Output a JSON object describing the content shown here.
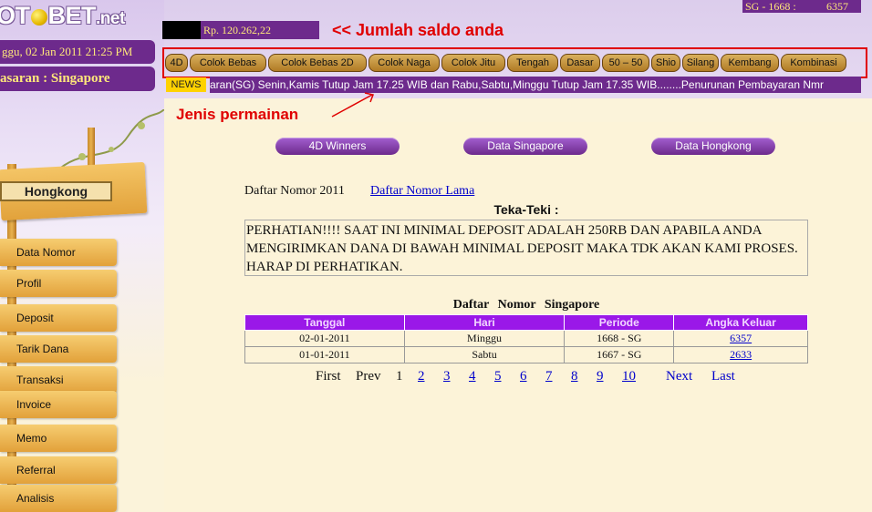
{
  "brand": {
    "logo_left": "OT",
    "logo_right": "BET",
    "logo_tld": ".net"
  },
  "header": {
    "datetime": "ggu, 02 Jan 2011 21:25 PM",
    "market": "asaran : Singapore",
    "sg_result_label": "SG - 1668 :",
    "sg_result_number": "6357",
    "saldo_value": "Rp. 120.262,22",
    "saldo_note": "<< Jumlah saldo anda",
    "jenis_note": "Jenis permainan"
  },
  "games": [
    "4D",
    "Colok Bebas",
    "Colok Bebas 2D",
    "Colok Naga",
    "Colok Jitu",
    "Tengah",
    "Dasar",
    "50 – 50",
    "Shio",
    "Silang",
    "Kembang",
    "Kombinasi"
  ],
  "news": {
    "label": "NEWS",
    "text": "aran(SG) Senin,Kamis Tutup Jam 17.25 WIB dan Rabu,Sabtu,Minggu Tutup Jam 17.35 WIB........Penurunan Pembayaran Nmr"
  },
  "sidebar": {
    "region_button": "Hongkong",
    "items": [
      "Data Nomor",
      "Profil",
      "Deposit",
      "Tarik Dana",
      "Transaksi",
      "Invoice",
      "Memo",
      "Referral",
      "Analisis"
    ]
  },
  "tabs": {
    "winners": "4D Winners",
    "singapore": "Data Singapore",
    "hongkong": "Data Hongkong"
  },
  "content": {
    "daftar_label": "Daftar Nomor 2011",
    "daftar_lama_link": "Daftar Nomor Lama",
    "teka_title": "Teka-Teki :",
    "teka_text": "PERHATIAN!!!! SAAT INI MINIMAL DEPOSIT ADALAH 250RB DAN APABILA ANDA MENGIRIMKAN DANA DI BAWAH MINIMAL DEPOSIT MAKA TDK AKAN KAMI PROSES. HARAP DI PERHATIKAN."
  },
  "table": {
    "title": "Daftar Nomor Singapore",
    "headers": [
      "Tanggal",
      "Hari",
      "Periode",
      "Angka Keluar"
    ],
    "rows": [
      {
        "tanggal": "02-01-2011",
        "hari": "Minggu",
        "periode": "1668 - SG",
        "angka": "6357"
      },
      {
        "tanggal": "01-01-2011",
        "hari": "Sabtu",
        "periode": "1667 - SG",
        "angka": "2633"
      }
    ]
  },
  "pager": {
    "first": "First",
    "prev": "Prev",
    "current": "1",
    "pages": [
      "2",
      "3",
      "4",
      "5",
      "6",
      "7",
      "8",
      "9",
      "10"
    ],
    "next": "Next",
    "last": "Last"
  },
  "colors": {
    "purple": "#6d2a8c",
    "header_purple": "#9a18e8",
    "annotation_red": "#e00000",
    "gold": "#e2a13a",
    "background": "#fcf3d8"
  }
}
